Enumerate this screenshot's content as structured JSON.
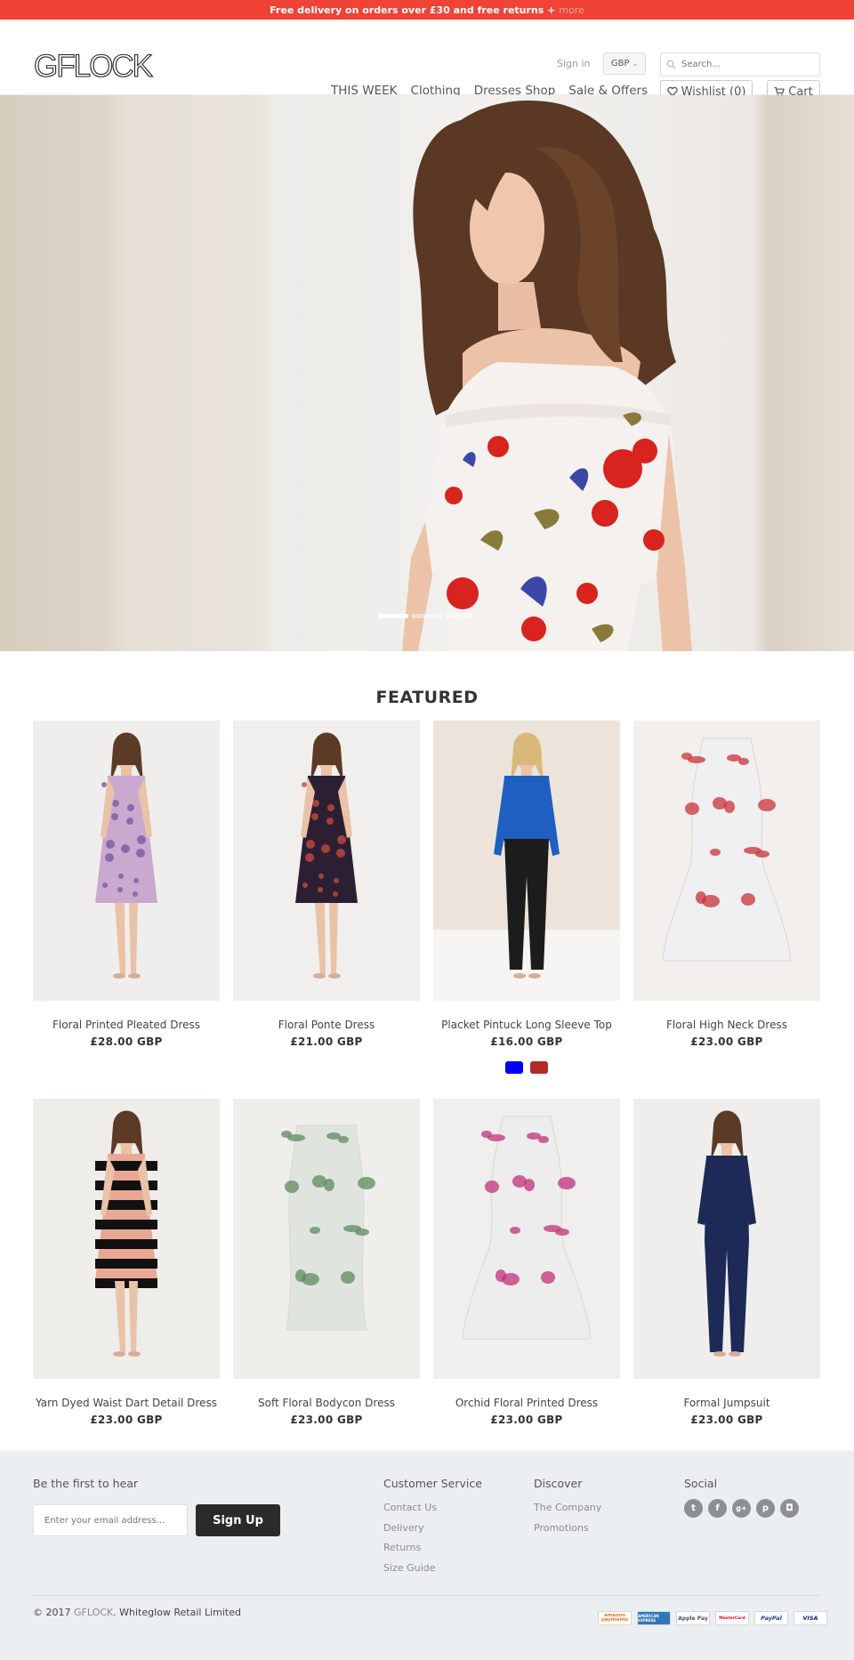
{
  "promo": {
    "text": "Free delivery on orders over £30 and free returns",
    "plus": "+",
    "more": "more"
  },
  "header": {
    "logo": "GFLOCK",
    "signin": "Sign in",
    "currency": "GBP",
    "search_placeholder": "Search...",
    "nav": [
      "THIS WEEK",
      "Clothing",
      "Dresses Shop",
      "Sale & Offers"
    ],
    "wishlist": "Wishlist (0)",
    "cart": "Cart"
  },
  "hero": {
    "slides": 3,
    "active_slide": 1
  },
  "featured": {
    "title": "FEATURED",
    "products": [
      {
        "name": "Floral Printed Pleated Dress",
        "price": "£28.00 GBP",
        "dress_color": "#c9a9cf",
        "accent": "#7a5ba0"
      },
      {
        "name": "Floral Ponte Dress",
        "price": "£21.00 GBP",
        "dress_color": "#2d1f33",
        "accent": "#c04a3c"
      },
      {
        "name": "Placket Pintuck Long Sleeve Top",
        "price": "£16.00 GBP",
        "dress_color": "#1f5fc2",
        "accent": "#1c1c1c",
        "swatches": [
          "#0000ff",
          "#b22a28"
        ]
      },
      {
        "name": "Floral High Neck Dress",
        "price": "£23.00 GBP",
        "dress_color": "#f0f0f2",
        "accent": "#c8323a"
      },
      {
        "name": "Yarn Dyed Waist Dart Detail Dress",
        "price": "£23.00 GBP",
        "dress_color": "#e8a893",
        "accent": "#111111"
      },
      {
        "name": "Soft Floral Bodycon Dress",
        "price": "£23.00 GBP",
        "dress_color": "#dfe5de",
        "accent": "#5d8a5e"
      },
      {
        "name": "Orchid Floral Printed Dress",
        "price": "£23.00 GBP",
        "dress_color": "#ededed",
        "accent": "#c0307a"
      },
      {
        "name": "Formal Jumpsuit",
        "price": "£23.00 GBP",
        "dress_color": "#1d2a57",
        "accent": "#1d2a57"
      }
    ]
  },
  "footer": {
    "newsletter_heading": "Be the first to hear",
    "email_placeholder": "Enter your email address...",
    "signup_label": "Sign Up",
    "customer_service": {
      "heading": "Customer Service",
      "links": [
        "Contact Us",
        "Delivery",
        "Returns",
        "Size Guide"
      ]
    },
    "discover": {
      "heading": "Discover",
      "links": [
        "The Company",
        "Promotions"
      ]
    },
    "social": {
      "heading": "Social",
      "icons": [
        "twitter-icon",
        "facebook-icon",
        "google-plus-icon",
        "pinterest-icon",
        "instagram-icon"
      ]
    },
    "copyright_prefix": "© 2017 ",
    "copyright_brand": "GFLOCK",
    "copyright_suffix": ". Whiteglow Retail Limited",
    "payments": [
      "amazon payments",
      "AMERICAN EXPRESS",
      "Apple Pay",
      "MasterCard",
      "PayPal",
      "VISA"
    ]
  },
  "colors": {
    "promo_bg": "#f14236",
    "footer_bg": "#eceff2",
    "signup_bg": "#2a2a2a"
  }
}
